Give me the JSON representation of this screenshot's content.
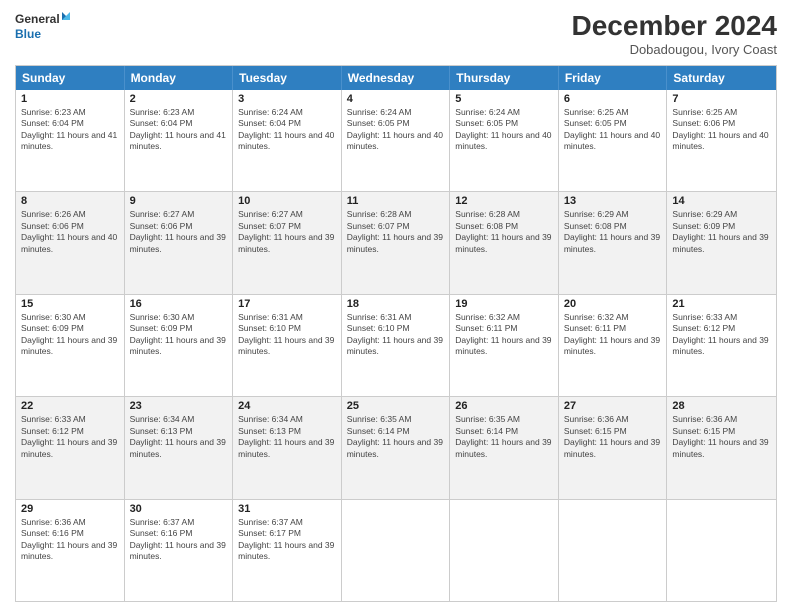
{
  "logo": {
    "line1": "General",
    "line2": "Blue"
  },
  "title": "December 2024",
  "location": "Dobadougou, Ivory Coast",
  "days_of_week": [
    "Sunday",
    "Monday",
    "Tuesday",
    "Wednesday",
    "Thursday",
    "Friday",
    "Saturday"
  ],
  "weeks": [
    [
      {
        "day": "1",
        "sunrise": "6:23 AM",
        "sunset": "6:04 PM",
        "daylight": "11 hours and 41 minutes."
      },
      {
        "day": "2",
        "sunrise": "6:23 AM",
        "sunset": "6:04 PM",
        "daylight": "11 hours and 41 minutes."
      },
      {
        "day": "3",
        "sunrise": "6:24 AM",
        "sunset": "6:04 PM",
        "daylight": "11 hours and 40 minutes."
      },
      {
        "day": "4",
        "sunrise": "6:24 AM",
        "sunset": "6:05 PM",
        "daylight": "11 hours and 40 minutes."
      },
      {
        "day": "5",
        "sunrise": "6:24 AM",
        "sunset": "6:05 PM",
        "daylight": "11 hours and 40 minutes."
      },
      {
        "day": "6",
        "sunrise": "6:25 AM",
        "sunset": "6:05 PM",
        "daylight": "11 hours and 40 minutes."
      },
      {
        "day": "7",
        "sunrise": "6:25 AM",
        "sunset": "6:06 PM",
        "daylight": "11 hours and 40 minutes."
      }
    ],
    [
      {
        "day": "8",
        "sunrise": "6:26 AM",
        "sunset": "6:06 PM",
        "daylight": "11 hours and 40 minutes."
      },
      {
        "day": "9",
        "sunrise": "6:27 AM",
        "sunset": "6:06 PM",
        "daylight": "11 hours and 39 minutes."
      },
      {
        "day": "10",
        "sunrise": "6:27 AM",
        "sunset": "6:07 PM",
        "daylight": "11 hours and 39 minutes."
      },
      {
        "day": "11",
        "sunrise": "6:28 AM",
        "sunset": "6:07 PM",
        "daylight": "11 hours and 39 minutes."
      },
      {
        "day": "12",
        "sunrise": "6:28 AM",
        "sunset": "6:08 PM",
        "daylight": "11 hours and 39 minutes."
      },
      {
        "day": "13",
        "sunrise": "6:29 AM",
        "sunset": "6:08 PM",
        "daylight": "11 hours and 39 minutes."
      },
      {
        "day": "14",
        "sunrise": "6:29 AM",
        "sunset": "6:09 PM",
        "daylight": "11 hours and 39 minutes."
      }
    ],
    [
      {
        "day": "15",
        "sunrise": "6:30 AM",
        "sunset": "6:09 PM",
        "daylight": "11 hours and 39 minutes."
      },
      {
        "day": "16",
        "sunrise": "6:30 AM",
        "sunset": "6:09 PM",
        "daylight": "11 hours and 39 minutes."
      },
      {
        "day": "17",
        "sunrise": "6:31 AM",
        "sunset": "6:10 PM",
        "daylight": "11 hours and 39 minutes."
      },
      {
        "day": "18",
        "sunrise": "6:31 AM",
        "sunset": "6:10 PM",
        "daylight": "11 hours and 39 minutes."
      },
      {
        "day": "19",
        "sunrise": "6:32 AM",
        "sunset": "6:11 PM",
        "daylight": "11 hours and 39 minutes."
      },
      {
        "day": "20",
        "sunrise": "6:32 AM",
        "sunset": "6:11 PM",
        "daylight": "11 hours and 39 minutes."
      },
      {
        "day": "21",
        "sunrise": "6:33 AM",
        "sunset": "6:12 PM",
        "daylight": "11 hours and 39 minutes."
      }
    ],
    [
      {
        "day": "22",
        "sunrise": "6:33 AM",
        "sunset": "6:12 PM",
        "daylight": "11 hours and 39 minutes."
      },
      {
        "day": "23",
        "sunrise": "6:34 AM",
        "sunset": "6:13 PM",
        "daylight": "11 hours and 39 minutes."
      },
      {
        "day": "24",
        "sunrise": "6:34 AM",
        "sunset": "6:13 PM",
        "daylight": "11 hours and 39 minutes."
      },
      {
        "day": "25",
        "sunrise": "6:35 AM",
        "sunset": "6:14 PM",
        "daylight": "11 hours and 39 minutes."
      },
      {
        "day": "26",
        "sunrise": "6:35 AM",
        "sunset": "6:14 PM",
        "daylight": "11 hours and 39 minutes."
      },
      {
        "day": "27",
        "sunrise": "6:36 AM",
        "sunset": "6:15 PM",
        "daylight": "11 hours and 39 minutes."
      },
      {
        "day": "28",
        "sunrise": "6:36 AM",
        "sunset": "6:15 PM",
        "daylight": "11 hours and 39 minutes."
      }
    ],
    [
      {
        "day": "29",
        "sunrise": "6:36 AM",
        "sunset": "6:16 PM",
        "daylight": "11 hours and 39 minutes."
      },
      {
        "day": "30",
        "sunrise": "6:37 AM",
        "sunset": "6:16 PM",
        "daylight": "11 hours and 39 minutes."
      },
      {
        "day": "31",
        "sunrise": "6:37 AM",
        "sunset": "6:17 PM",
        "daylight": "11 hours and 39 minutes."
      },
      null,
      null,
      null,
      null
    ]
  ]
}
